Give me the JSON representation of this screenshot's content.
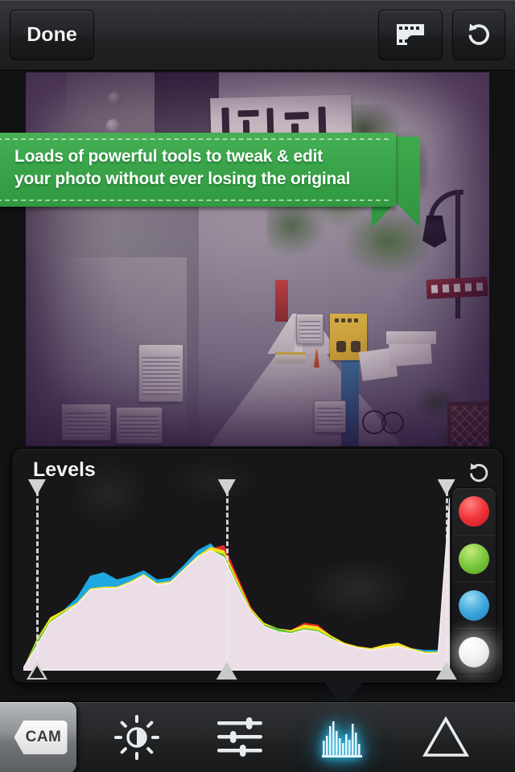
{
  "app": {
    "screen_name": "photo-editor-levels",
    "accent_selected": "#35d4ff",
    "banner_green": "#3aa44a"
  },
  "topbar": {
    "done_label": "Done",
    "film_icon": "film-strip-icon",
    "reset_icon": "rotate-counterclockwise-icon"
  },
  "tooltip": {
    "line1": "Loads of powerful tools to tweak & edit",
    "line2": "your photo without ever losing the original",
    "full_text": "Loads of powerful tools to tweak & edit your photo without ever losing the original",
    "style": "green-ribbon"
  },
  "photo": {
    "alt": "Japanese alleyway with shop signs, air conditioners and street lamp",
    "filter_look": "vintage purple fade"
  },
  "levels": {
    "title": "Levels",
    "reset_icon": "rotate-counterclockwise-icon",
    "channels": [
      {
        "name": "red",
        "color": "#f1363c",
        "selected": false
      },
      {
        "name": "green",
        "color": "#7dc93f",
        "selected": false
      },
      {
        "name": "blue",
        "color": "#41a9de",
        "selected": false
      },
      {
        "name": "rgb",
        "color": "#f2f2f2",
        "selected": true
      }
    ],
    "sliders": {
      "black_point": 0,
      "mid_point": 46,
      "white_point": 99
    }
  },
  "chart_data": {
    "type": "area",
    "title": "Levels",
    "xlabel": "",
    "ylabel": "",
    "xlim": [
      0,
      255
    ],
    "ylim": [
      0,
      100
    ],
    "grid": false,
    "legend": [
      "Red",
      "Green",
      "Blue",
      "Luminance"
    ],
    "legend_position": "right-column",
    "annotations": [
      {
        "name": "black-point-marker",
        "x": 0,
        "label": ""
      },
      {
        "name": "mid-point-marker",
        "x": 117,
        "label": ""
      },
      {
        "name": "white-point-marker",
        "x": 252,
        "label": ""
      }
    ],
    "x": [
      0,
      8,
      16,
      24,
      32,
      40,
      48,
      56,
      64,
      72,
      80,
      88,
      96,
      104,
      112,
      120,
      128,
      136,
      144,
      152,
      160,
      168,
      176,
      184,
      192,
      200,
      208,
      216,
      224,
      232,
      240,
      248,
      255
    ],
    "series": [
      {
        "name": "Luminance",
        "color": "#ecdee6",
        "values": [
          1,
          13,
          26,
          31,
          36,
          44,
          45,
          45,
          48,
          52,
          47,
          48,
          55,
          62,
          66,
          62,
          46,
          32,
          24,
          21,
          20,
          22,
          21,
          17,
          14,
          12,
          11,
          12,
          13,
          11,
          9,
          9,
          95
        ]
      },
      {
        "name": "Red",
        "color": "#e8292b",
        "values": [
          1,
          14,
          27,
          31,
          35,
          43,
          44,
          44,
          47,
          51,
          46,
          47,
          54,
          61,
          67,
          69,
          52,
          35,
          25,
          22,
          22,
          26,
          25,
          19,
          15,
          13,
          12,
          14,
          15,
          12,
          10,
          10,
          93
        ]
      },
      {
        "name": "Green",
        "color": "#5bc23a",
        "values": [
          1,
          16,
          27,
          32,
          36,
          44,
          45,
          45,
          48,
          52,
          47,
          48,
          55,
          62,
          66,
          64,
          48,
          33,
          25,
          23,
          21,
          23,
          22,
          18,
          14,
          12,
          11,
          12,
          13,
          11,
          9,
          9,
          94
        ]
      },
      {
        "name": "Blue",
        "color": "#1fa7e0",
        "values": [
          1,
          12,
          25,
          33,
          40,
          52,
          54,
          50,
          52,
          55,
          50,
          51,
          58,
          66,
          70,
          62,
          44,
          31,
          25,
          22,
          20,
          21,
          20,
          16,
          13,
          11,
          11,
          12,
          13,
          12,
          11,
          11,
          92
        ]
      },
      {
        "name": "Yellow overlap",
        "color": "#f2e21c",
        "values": [
          1,
          17,
          29,
          33,
          37,
          45,
          46,
          46,
          49,
          53,
          48,
          49,
          56,
          63,
          68,
          66,
          50,
          34,
          26,
          23,
          22,
          25,
          24,
          19,
          15,
          13,
          12,
          14,
          15,
          12,
          10,
          10,
          96
        ]
      }
    ]
  },
  "bottombar": {
    "cam_label": "CAM",
    "tools": [
      {
        "name": "brightness",
        "icon": "sun-brightness-icon",
        "selected": false
      },
      {
        "name": "adjust",
        "icon": "sliders-icon",
        "selected": false
      },
      {
        "name": "levels",
        "icon": "histogram-icon",
        "selected": true
      },
      {
        "name": "curves",
        "icon": "triangle-curves-icon",
        "selected": false
      }
    ]
  }
}
